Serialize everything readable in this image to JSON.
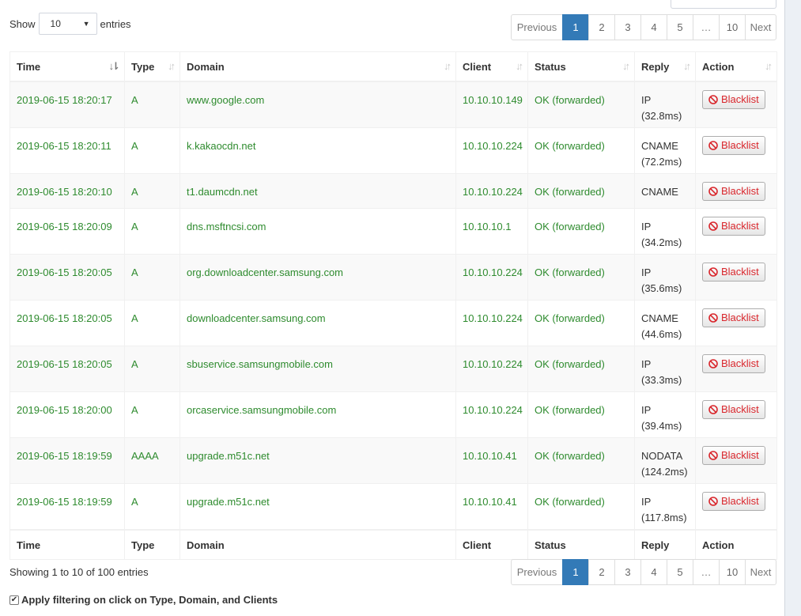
{
  "length_menu": {
    "prefix": "Show",
    "selected": "10",
    "suffix": "entries"
  },
  "pagination": {
    "previous": "Previous",
    "pages": [
      "1",
      "2",
      "3",
      "4",
      "5"
    ],
    "ellipsis": "…",
    "last": "10",
    "next": "Next",
    "active_page": "1"
  },
  "table": {
    "columns": [
      "Time",
      "Type",
      "Domain",
      "Client",
      "Status",
      "Reply",
      "Action"
    ],
    "rows": [
      {
        "time": "2019-06-15 18:20:17",
        "type": "A",
        "domain": "www.google.com",
        "client": "10.10.10.149",
        "status": "OK (forwarded)",
        "reply": "IP",
        "reply_time": "(32.8ms)",
        "action": "Blacklist"
      },
      {
        "time": "2019-06-15 18:20:11",
        "type": "A",
        "domain": "k.kakaocdn.net",
        "client": "10.10.10.224",
        "status": "OK (forwarded)",
        "reply": "CNAME",
        "reply_time": "(72.2ms)",
        "action": "Blacklist"
      },
      {
        "time": "2019-06-15 18:20:10",
        "type": "A",
        "domain": "t1.daumcdn.net",
        "client": "10.10.10.224",
        "status": "OK (forwarded)",
        "reply": "CNAME",
        "reply_time": "",
        "action": "Blacklist"
      },
      {
        "time": "2019-06-15 18:20:09",
        "type": "A",
        "domain": "dns.msftncsi.com",
        "client": "10.10.10.1",
        "status": "OK (forwarded)",
        "reply": "IP",
        "reply_time": "(34.2ms)",
        "action": "Blacklist"
      },
      {
        "time": "2019-06-15 18:20:05",
        "type": "A",
        "domain": "org.downloadcenter.samsung.com",
        "client": "10.10.10.224",
        "status": "OK (forwarded)",
        "reply": "IP",
        "reply_time": "(35.6ms)",
        "action": "Blacklist"
      },
      {
        "time": "2019-06-15 18:20:05",
        "type": "A",
        "domain": "downloadcenter.samsung.com",
        "client": "10.10.10.224",
        "status": "OK (forwarded)",
        "reply": "CNAME",
        "reply_time": "(44.6ms)",
        "action": "Blacklist"
      },
      {
        "time": "2019-06-15 18:20:05",
        "type": "A",
        "domain": "sbuservice.samsungmobile.com",
        "client": "10.10.10.224",
        "status": "OK (forwarded)",
        "reply": "IP",
        "reply_time": "(33.3ms)",
        "action": "Blacklist"
      },
      {
        "time": "2019-06-15 18:20:00",
        "type": "A",
        "domain": "orcaservice.samsungmobile.com",
        "client": "10.10.10.224",
        "status": "OK (forwarded)",
        "reply": "IP",
        "reply_time": "(39.4ms)",
        "action": "Blacklist"
      },
      {
        "time": "2019-06-15 18:19:59",
        "type": "AAAA",
        "domain": "upgrade.m51c.net",
        "client": "10.10.10.41",
        "status": "OK (forwarded)",
        "reply": "NODATA",
        "reply_time": "(124.2ms)",
        "action": "Blacklist"
      },
      {
        "time": "2019-06-15 18:19:59",
        "type": "A",
        "domain": "upgrade.m51c.net",
        "client": "10.10.10.41",
        "status": "OK (forwarded)",
        "reply": "IP",
        "reply_time": "(117.8ms)",
        "action": "Blacklist"
      }
    ]
  },
  "info": "Showing 1 to 10 of 100 entries",
  "filter": {
    "checked": true,
    "check_glyph": "✔",
    "label": "Apply filtering on click on Type, Domain, and Clients"
  },
  "icons": {
    "sort_both": "sort-icon",
    "sort_desc": "sort-desc-icon",
    "blacklist": "ban-icon",
    "dropdown": "caret-down-icon"
  },
  "colors": {
    "allowed_text": "#2e8b2e",
    "active_page": "#337ab7",
    "blacklist_text": "#d9262c"
  }
}
